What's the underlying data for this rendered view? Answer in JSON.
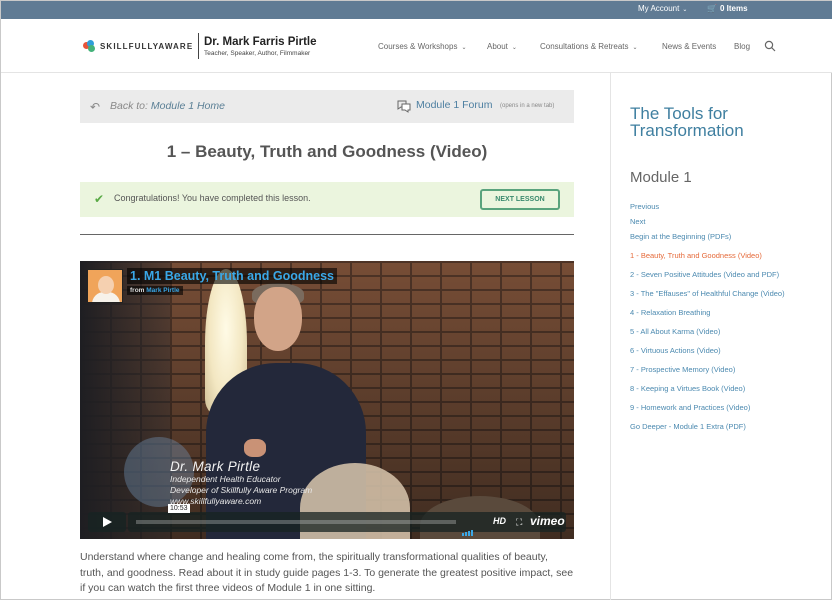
{
  "topbar": {
    "account_label": "My Account",
    "cart_label": "0 Items"
  },
  "header": {
    "logo_text": "SKILLFULLYAWARE",
    "site_name": "Dr. Mark Farris Pirtle",
    "site_tagline": "Teacher, Speaker, Author, Filmmaker",
    "nav": [
      {
        "label": "Courses & Workshops",
        "has_dropdown": true
      },
      {
        "label": "About",
        "has_dropdown": true
      },
      {
        "label": "Consultations & Retreats",
        "has_dropdown": true
      },
      {
        "label": "News & Events",
        "has_dropdown": false
      },
      {
        "label": "Blog",
        "has_dropdown": false
      }
    ]
  },
  "lesson_nav": {
    "back_prefix": "Back to:",
    "back_link": "Module 1 Home",
    "forum_link": "Module 1 Forum",
    "forum_note": "(opens in a new tab)"
  },
  "lesson": {
    "title": "1 – Beauty, Truth and Goodness (Video)",
    "completed_message": "Congratulations! You have completed this lesson.",
    "next_button": "NEXT LESSON",
    "description": "Understand where change and healing come from, the spiritually transformational qualities of beauty, truth, and goodness. Read about it in study guide pages 1-3. To generate the greatest positive impact, see if you can watch the first three videos of Module 1 in one sitting."
  },
  "video": {
    "title": "1. M1 Beauty, Truth and Goodness",
    "from_prefix": "from",
    "from_name": "Mark Pirtle",
    "overlay_name": "Dr. Mark Pirtle",
    "overlay_line1": "Independent Health Educator",
    "overlay_line2": "Developer of Skillfully Aware Program",
    "overlay_line3": "www.skillfullyaware.com",
    "duration": "10:53",
    "hd_label": "HD",
    "player_brand": "vimeo"
  },
  "sidebar": {
    "title": "The Tools for Transformation",
    "module": "Module 1",
    "items": [
      {
        "label": "Previous",
        "active": false
      },
      {
        "label": "Next",
        "active": false
      },
      {
        "label": "Begin at the Beginning (PDFs)",
        "active": false
      },
      {
        "label": "1 - Beauty, Truth and Goodness (Video)",
        "active": true
      },
      {
        "label": "2 - Seven Positive Attitudes (Video and PDF)",
        "active": false
      },
      {
        "label": "3 - The \"Effauses\" of Healthful Change (Video)",
        "active": false
      },
      {
        "label": "4 - Relaxation Breathing",
        "active": false
      },
      {
        "label": "5 - All About Karma (Video)",
        "active": false
      },
      {
        "label": "6 - Virtuous Actions (Video)",
        "active": false
      },
      {
        "label": "7 - Prospective Memory (Video)",
        "active": false
      },
      {
        "label": "8 - Keeping a Virtues Book (Video)",
        "active": false
      },
      {
        "label": "9 - Homework and Practices (Video)",
        "active": false
      },
      {
        "label": "Go Deeper - Module 1 Extra (PDF)",
        "active": false
      }
    ]
  },
  "colors": {
    "topbar": "#607b94",
    "link": "#4c8ab0",
    "active_link": "#e56a3a",
    "success_bg": "#ebf5de",
    "next_button_border": "#5aa37d"
  }
}
